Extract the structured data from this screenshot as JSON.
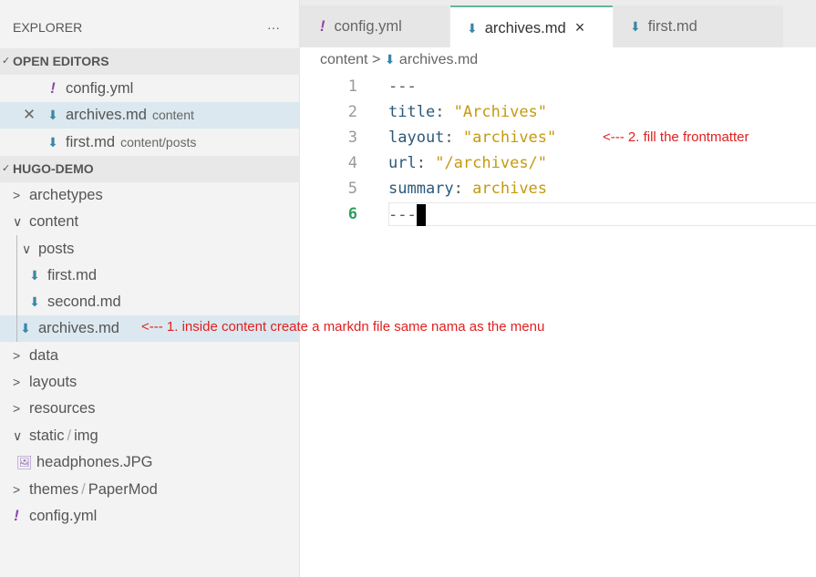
{
  "sidebar": {
    "title": "EXPLORER",
    "more": "···",
    "open_editors": {
      "label": "OPEN EDITORS",
      "items": [
        {
          "name": "config.yml",
          "desc": ""
        },
        {
          "name": "archives.md",
          "desc": "content"
        },
        {
          "name": "first.md",
          "desc": "content/posts"
        }
      ]
    },
    "project": {
      "label": "HUGO-DEMO",
      "items": [
        "archetypes",
        "content",
        "posts",
        "first.md",
        "second.md",
        "archives.md",
        "data",
        "layouts",
        "resources",
        "static",
        "img",
        "headphones.JPG",
        "themes",
        "PaperMod",
        "config.yml"
      ]
    },
    "sep": "/"
  },
  "tabs": [
    {
      "label": "config.yml"
    },
    {
      "label": "archives.md",
      "close": "×"
    },
    {
      "label": "first.md"
    }
  ],
  "breadcrumb": {
    "folder": "content",
    "sep": ">",
    "file": "archives.md"
  },
  "editor": {
    "line_numbers": [
      "1",
      "2",
      "3",
      "4",
      "5",
      "6"
    ],
    "lines": [
      {
        "text": "---"
      },
      {
        "key": "title",
        "val": "\"Archives\""
      },
      {
        "key": "layout",
        "val": "\"archives\""
      },
      {
        "key": "url",
        "val": "\"/archives/\""
      },
      {
        "key": "summary",
        "val": "archives"
      },
      {
        "text": "---"
      }
    ]
  },
  "annotations": {
    "note1": "<--- 1.  inside content create a markdn file same nama as the menu",
    "note2": "<--- 2. fill the frontmatter"
  },
  "colors": {
    "accent": "#5fb896",
    "annotation": "#e02020",
    "markdown_icon": "#3a86a8"
  }
}
